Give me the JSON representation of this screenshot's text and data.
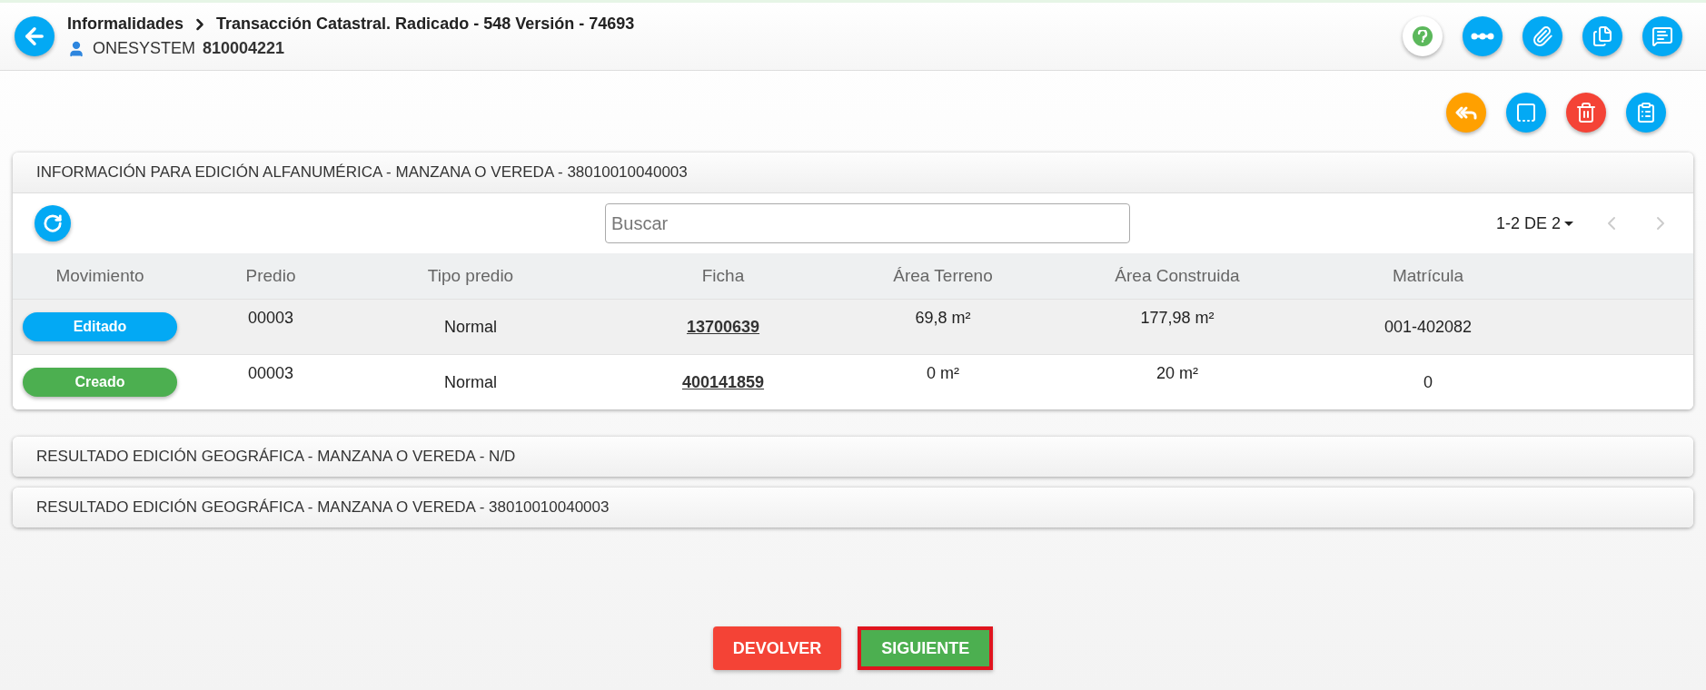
{
  "header": {
    "breadcrumb": [
      "Informalidades",
      "Transacción Catastral. Radicado - 548 Versión - 74693"
    ],
    "user": {
      "name": "ONESYSTEM",
      "id": "810004221"
    }
  },
  "panels": [
    {
      "title": "INFORMACIÓN PARA EDICIÓN ALFANUMÉRICA - MANZANA O VEREDA - 38010010040003",
      "expanded": true,
      "search": {
        "placeholder": "Buscar"
      },
      "pager": {
        "label": "1-2 DE 2",
        "prev_disabled": true,
        "next_disabled": true
      },
      "table": {
        "columns": [
          "Movimiento",
          "Predio",
          "Tipo predio",
          "Ficha",
          "Área Terreno",
          "Área Construida",
          "Matrícula"
        ],
        "rows": [
          {
            "cells": [
              {
                "label": "Editado",
                "color": "#03a9f4"
              },
              "00003",
              "Normal",
              "13700639",
              "69,8 m²",
              "177,98 m²",
              "001-402082"
            ]
          },
          {
            "cells": [
              {
                "label": "Creado",
                "color": "#4caf50"
              },
              "00003",
              "Normal",
              "400141859",
              "0 m²",
              "20 m²",
              "0"
            ]
          }
        ]
      }
    },
    {
      "title": "RESULTADO EDICIÓN GEOGRÁFICA - MANZANA O VEREDA - N/D",
      "expanded": false
    },
    {
      "title": "RESULTADO EDICIÓN GEOGRÁFICA - MANZANA O VEREDA - 38010010040003",
      "expanded": false
    }
  ],
  "actions": [
    {
      "label": "DEVOLVER",
      "kind": "return",
      "outlined": false
    },
    {
      "label": "SIGUIENTE",
      "kind": "next",
      "outlined": true
    }
  ]
}
